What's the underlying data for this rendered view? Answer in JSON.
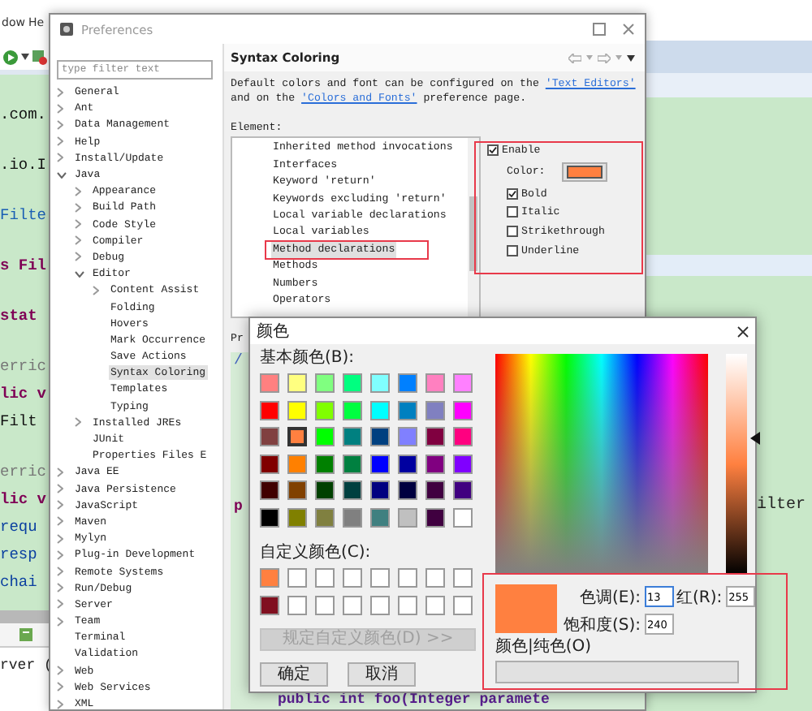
{
  "background_editor": {
    "menu": [
      "dow",
      "He"
    ],
    "code_blocks": [
      [
        {
          "text": ".com.",
          "kind": "plain"
        }
      ],
      [
        {
          "text": ".io.I",
          "kind": "plain"
        }
      ],
      [
        {
          "text": "Filte",
          "kind": "type"
        }
      ],
      [
        {
          "text": "s Fil",
          "kind": "keyword"
        }
      ],
      [
        {
          "text": "stat",
          "kind": "keyword"
        }
      ],
      [
        {
          "text": "erric",
          "kind": "annotation"
        },
        {
          "text": "lic v",
          "kind": "keyword"
        },
        {
          "text": "Filt",
          "kind": "plain"
        }
      ],
      [
        {
          "text": "erric",
          "kind": "annotation"
        },
        {
          "text": "lic v",
          "kind": "keyword"
        },
        {
          "text": "requ",
          "kind": "field"
        },
        {
          "text": "resp",
          "kind": "field"
        },
        {
          "text": "chai",
          "kind": "field"
        }
      ]
    ],
    "console_text": "rver (",
    "right_code": "ilter"
  },
  "preferences": {
    "title": "Preferences",
    "filter": {
      "placeholder": "type filter text"
    },
    "tree": [
      {
        "label": "General",
        "expanded": false,
        "selected": false
      },
      {
        "label": "Ant",
        "expanded": false,
        "selected": false
      },
      {
        "label": "Data Management",
        "expanded": false,
        "selected": false
      },
      {
        "label": "Help",
        "expanded": false,
        "selected": false
      },
      {
        "label": "Install/Update",
        "expanded": false,
        "selected": false
      },
      {
        "label": "Java",
        "expanded": true,
        "selected": false,
        "children": [
          {
            "label": "Appearance",
            "expanded": false,
            "selected": false
          },
          {
            "label": "Build Path",
            "expanded": false,
            "selected": false
          },
          {
            "label": "Code Style",
            "expanded": false,
            "selected": false
          },
          {
            "label": "Compiler",
            "expanded": false,
            "selected": false
          },
          {
            "label": "Debug",
            "expanded": false,
            "selected": false
          },
          {
            "label": "Editor",
            "expanded": true,
            "selected": false,
            "children": [
              {
                "label": "Content Assist",
                "expanded": false,
                "selected": false
              },
              {
                "label": "Folding",
                "selected": false
              },
              {
                "label": "Hovers",
                "selected": false
              },
              {
                "label": "Mark Occurrence",
                "selected": false
              },
              {
                "label": "Save Actions",
                "selected": false
              },
              {
                "label": "Syntax Coloring",
                "selected": true
              },
              {
                "label": "Templates",
                "selected": false
              },
              {
                "label": "Typing",
                "selected": false
              }
            ]
          },
          {
            "label": "Installed JREs",
            "expanded": false,
            "selected": false
          },
          {
            "label": "JUnit",
            "selected": false
          },
          {
            "label": "Properties Files E",
            "selected": false
          }
        ]
      },
      {
        "label": "Java EE",
        "expanded": false,
        "selected": false
      },
      {
        "label": "Java Persistence",
        "expanded": false,
        "selected": false
      },
      {
        "label": "JavaScript",
        "expanded": false,
        "selected": false
      },
      {
        "label": "Maven",
        "expanded": false,
        "selected": false
      },
      {
        "label": "Mylyn",
        "expanded": false,
        "selected": false
      },
      {
        "label": "Plug-in Development",
        "expanded": false,
        "selected": false
      },
      {
        "label": "Remote Systems",
        "expanded": false,
        "selected": false
      },
      {
        "label": "Run/Debug",
        "expanded": false,
        "selected": false
      },
      {
        "label": "Server",
        "expanded": false,
        "selected": false
      },
      {
        "label": "Team",
        "expanded": false,
        "selected": false
      },
      {
        "label": "Terminal",
        "selected": false
      },
      {
        "label": "Validation",
        "selected": false
      },
      {
        "label": "Web",
        "expanded": false,
        "selected": false
      },
      {
        "label": "Web Services",
        "expanded": false,
        "selected": false
      },
      {
        "label": "XML",
        "expanded": false,
        "selected": false
      }
    ],
    "page_title": "Syntax Coloring",
    "description": [
      {
        "kind": "text",
        "text": "Default colors and font can be configured on the "
      },
      {
        "kind": "link",
        "text": "'Text Editors'"
      },
      {
        "kind": "text",
        "text": " and on the "
      },
      {
        "kind": "link",
        "text": "'Colors and Fonts'"
      },
      {
        "kind": "text",
        "text": " preference page."
      }
    ],
    "element_label": "Element:",
    "elements": [
      {
        "label": "Inherited method invocations",
        "selected": false
      },
      {
        "label": "Interfaces",
        "selected": false
      },
      {
        "label": "Keyword 'return'",
        "selected": false
      },
      {
        "label": "Keywords excluding 'return'",
        "selected": false
      },
      {
        "label": "Local variable declarations",
        "selected": false
      },
      {
        "label": "Local variables",
        "selected": false
      },
      {
        "label": "Method declarations",
        "selected": true
      },
      {
        "label": "Methods",
        "selected": false
      },
      {
        "label": "Numbers",
        "selected": false
      },
      {
        "label": "Operators",
        "selected": false
      }
    ],
    "enable": {
      "label": "Enable",
      "checked": true
    },
    "options": [
      {
        "kind": "color",
        "label": "Color:",
        "color": "#ff8040"
      },
      {
        "kind": "checkbox",
        "label": "Bold",
        "checked": true
      },
      {
        "kind": "checkbox",
        "label": "Italic",
        "checked": false
      },
      {
        "kind": "checkbox",
        "label": "Strikethrough",
        "checked": false
      },
      {
        "kind": "checkbox",
        "label": "Underline",
        "checked": false
      }
    ],
    "preview_label": "Pr",
    "preview_lines": [
      {
        "text": "/",
        "kind": "comment"
      },
      {
        "text": "p",
        "kind": "keyword"
      },
      {
        "text": "public int foo(Integer paramete",
        "kind": "method"
      }
    ]
  },
  "color_dialog": {
    "title": "颜色",
    "basic_label": "基本颜色(B):",
    "basic_colors": [
      {
        "color": "#ff8080",
        "selected": false
      },
      {
        "color": "#ffff80",
        "selected": false
      },
      {
        "color": "#80ff80",
        "selected": false
      },
      {
        "color": "#00ff80",
        "selected": false
      },
      {
        "color": "#80ffff",
        "selected": false
      },
      {
        "color": "#0080ff",
        "selected": false
      },
      {
        "color": "#ff80c0",
        "selected": false
      },
      {
        "color": "#ff80ff",
        "selected": false
      },
      {
        "color": "#ff0000",
        "selected": false
      },
      {
        "color": "#ffff00",
        "selected": false
      },
      {
        "color": "#80ff00",
        "selected": false
      },
      {
        "color": "#00ff40",
        "selected": false
      },
      {
        "color": "#00ffff",
        "selected": false
      },
      {
        "color": "#0080c0",
        "selected": false
      },
      {
        "color": "#8080c0",
        "selected": false
      },
      {
        "color": "#ff00ff",
        "selected": false
      },
      {
        "color": "#804040",
        "selected": false
      },
      {
        "color": "#ff8040",
        "selected": true
      },
      {
        "color": "#00ff00",
        "selected": false
      },
      {
        "color": "#008080",
        "selected": false
      },
      {
        "color": "#004080",
        "selected": false
      },
      {
        "color": "#8080ff",
        "selected": false
      },
      {
        "color": "#800040",
        "selected": false
      },
      {
        "color": "#ff0080",
        "selected": false
      },
      {
        "color": "#800000",
        "selected": false
      },
      {
        "color": "#ff8000",
        "selected": false
      },
      {
        "color": "#008000",
        "selected": false
      },
      {
        "color": "#008040",
        "selected": false
      },
      {
        "color": "#0000ff",
        "selected": false
      },
      {
        "color": "#0000a0",
        "selected": false
      },
      {
        "color": "#800080",
        "selected": false
      },
      {
        "color": "#8000ff",
        "selected": false
      },
      {
        "color": "#400000",
        "selected": false
      },
      {
        "color": "#804000",
        "selected": false
      },
      {
        "color": "#004000",
        "selected": false
      },
      {
        "color": "#004040",
        "selected": false
      },
      {
        "color": "#000080",
        "selected": false
      },
      {
        "color": "#000040",
        "selected": false
      },
      {
        "color": "#400040",
        "selected": false
      },
      {
        "color": "#400080",
        "selected": false
      },
      {
        "color": "#000000",
        "selected": false
      },
      {
        "color": "#808000",
        "selected": false
      },
      {
        "color": "#808040",
        "selected": false
      },
      {
        "color": "#808080",
        "selected": false
      },
      {
        "color": "#408080",
        "selected": false
      },
      {
        "color": "#c0c0c0",
        "selected": false
      },
      {
        "color": "#400040",
        "selected": false
      },
      {
        "color": "#ffffff",
        "selected": false
      }
    ],
    "custom_label": "自定义颜色(C):",
    "custom_colors": [
      {
        "color": "#ff8040"
      },
      {
        "color": "#ffffff"
      },
      {
        "color": "#ffffff"
      },
      {
        "color": "#ffffff"
      },
      {
        "color": "#ffffff"
      },
      {
        "color": "#ffffff"
      },
      {
        "color": "#ffffff"
      },
      {
        "color": "#ffffff"
      },
      {
        "color": "#801020"
      },
      {
        "color": "#ffffff"
      },
      {
        "color": "#ffffff"
      },
      {
        "color": "#ffffff"
      },
      {
        "color": "#ffffff"
      },
      {
        "color": "#ffffff"
      },
      {
        "color": "#ffffff"
      },
      {
        "color": "#ffffff"
      }
    ],
    "define_button": {
      "label": "规定自定义颜色(D) >>",
      "disabled": true
    },
    "buttons": [
      "确定",
      "取消"
    ],
    "luminance": {
      "level": 0.62
    },
    "preview": {
      "color": "#ff8040"
    },
    "current_label": "颜色|纯色(O)",
    "fields": [
      {
        "label": "色调(E):",
        "value": "13",
        "focused": true
      },
      {
        "label": "红(R):",
        "value": "255",
        "focused": false
      },
      {
        "label": "饱和度(S):",
        "value": "240",
        "focused": false
      }
    ]
  }
}
